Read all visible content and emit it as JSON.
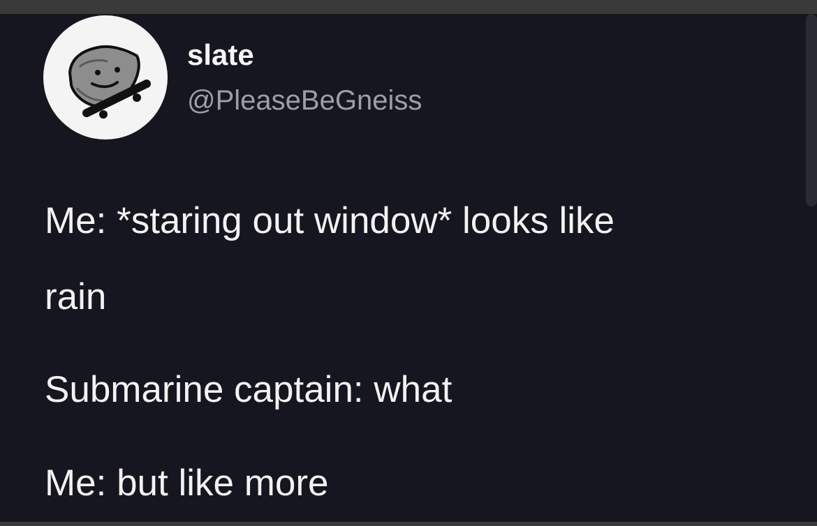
{
  "tweet": {
    "display_name": "slate",
    "handle": "@PleaseBeGneiss",
    "avatar_icon": "rock-character-avatar",
    "lines": [
      "Me: *staring out window* looks like",
      "rain",
      "Submarine captain: what",
      "Me: but like more"
    ]
  },
  "colors": {
    "background": "#161620",
    "text": "#f2f2f2",
    "handle": "#9aa0a8",
    "avatar_bg": "#f4f4f4"
  }
}
